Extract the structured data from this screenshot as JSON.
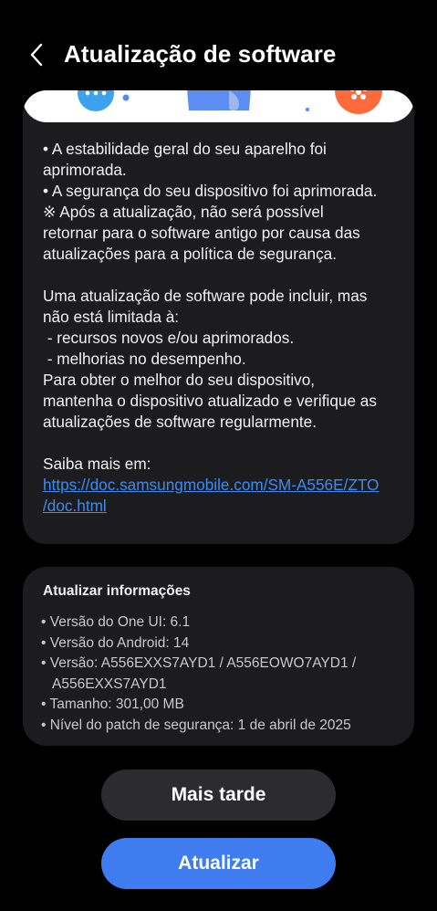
{
  "header": {
    "title": "Atualização de software"
  },
  "release_notes": {
    "lines": [
      "• A estabilidade geral do seu aparelho foi",
      "aprimorada.",
      "• A segurança do seu dispositivo foi aprimorada.",
      "※ Após a atualização, não será possível",
      "retornar para o software antigo por causa das",
      "atualizações para a política de segurança.",
      "",
      "Uma atualização de software pode incluir, mas",
      "não está limitada à:",
      " - recursos novos e/ou aprimorados.",
      " - melhorias no desempenho.",
      "Para obter o melhor do seu dispositivo,",
      "mantenha o dispositivo atualizado e verifique as",
      "atualizações de software regularmente.",
      "",
      "Saiba mais em:"
    ],
    "link_line1": "https://doc.samsungmobile.com/SM-A556E/ZTO",
    "link_line2": "/doc.html"
  },
  "update_info": {
    "title": "Atualizar informações",
    "one_ui": "• Versão do One UI: 6.1",
    "android": "• Versão do Android: 14",
    "version_line1": "• Versão: A556EXXS7AYD1 / A556EOWO7AYD1 /",
    "version_line2": "A556EXXS7AYD1",
    "size": "• Tamanho: 301,00 MB",
    "patch": "• Nível do patch de segurança: 1 de abril de 2025"
  },
  "buttons": {
    "later": "Mais tarde",
    "update": "Atualizar"
  },
  "colors": {
    "accent": "#3e7cf0",
    "link": "#3a8cf5",
    "card": "#1c1c1e"
  }
}
